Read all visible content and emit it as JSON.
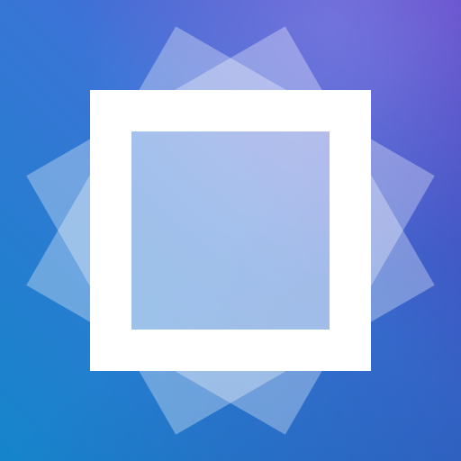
{
  "icon": {
    "name": "frame-icon",
    "colors": {
      "background_top_left": "#3f79dc",
      "background_top_right": "#6a48cc",
      "background_bottom_left": "#1684cc",
      "background_bottom_right": "#2c4fb6",
      "glow": "#7d86e6",
      "frame": "#ffffff"
    },
    "layers": [
      {
        "name": "rotated-square-layer",
        "shape": "square",
        "rotation_deg": 30
      },
      {
        "name": "rotated-square-layer",
        "shape": "square",
        "rotation_deg": -30
      },
      {
        "name": "frame-square",
        "shape": "square-outline",
        "rotation_deg": 0
      }
    ]
  }
}
